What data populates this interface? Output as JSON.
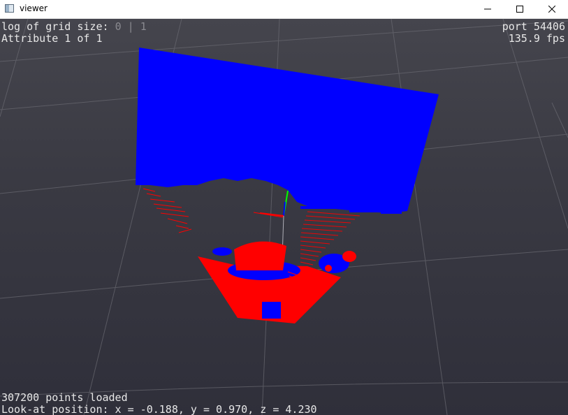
{
  "window": {
    "title": "viewer",
    "icon": "app-window-icon",
    "buttons": {
      "minimize": "minimize-icon",
      "maximize": "maximize-icon",
      "close": "close-icon"
    }
  },
  "hud": {
    "grid_label": "log of grid size:",
    "grid_value_a": "0",
    "grid_sep": "|",
    "grid_value_b": "1",
    "attribute": "Attribute 1 of 1",
    "port": "port 54406",
    "fps": "135.9 fps",
    "points": "307200 points loaded",
    "lookat": "Look-at position: x = -0.188, y = 0.970, z = 4.230"
  },
  "colors": {
    "background": "#3a3a43",
    "grid": "#6a6a72",
    "point_blue": "#0000ff",
    "point_red": "#ff0000",
    "axis_green": "#00ff00"
  }
}
